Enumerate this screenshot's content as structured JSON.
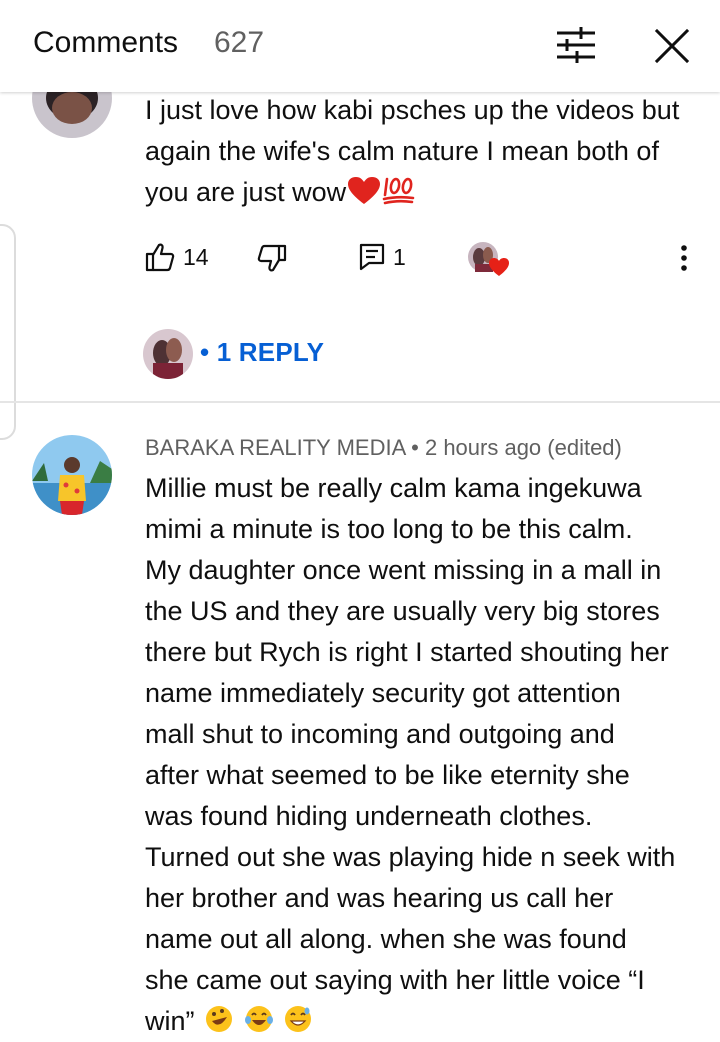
{
  "header": {
    "title": "Comments",
    "count": "627",
    "filter_icon": "sliders-icon",
    "close_icon": "close-icon"
  },
  "comment_1": {
    "text": "I just love how kabi psches up the videos but again the wife's calm nature I mean both of you are just wow",
    "emojis": [
      "red-heart",
      "hundred-points"
    ],
    "likes": "14",
    "replies": "1",
    "reply_link": "• 1 REPLY",
    "icons": {
      "like": "thumbs-up-icon",
      "dislike": "thumbs-down-icon",
      "reply": "comment-icon",
      "menu": "more-vertical-icon",
      "creator_heart": "creator-heart-badge"
    },
    "colors": {
      "link": "#065fd4",
      "heart": "#e0241e"
    }
  },
  "comment_2": {
    "author": "BARAKA REALITY MEDIA",
    "separator": " • ",
    "time": "2 hours ago (edited)",
    "lines": [
      "Millie must be really calm kama ingekuwa",
      "mimi a minute is too long to be this calm.",
      "My daughter once went missing in a mall in",
      "the US and they are usually very big stores",
      "there but Rych is right I started shouting her",
      "name immediately security got attention",
      "mall shut to incoming and outgoing and",
      "after what seemed to be like eternity she",
      "was found hiding underneath clothes.",
      "Turned out she was playing hide n seek with",
      "her brother and was hearing us call her",
      "name out all along. when she was found",
      "she came out saying with her little voice “I",
      "win”"
    ],
    "emojis": [
      "rolling-on-floor-laughing",
      "tears-of-joy",
      "grinning-sweat"
    ]
  }
}
